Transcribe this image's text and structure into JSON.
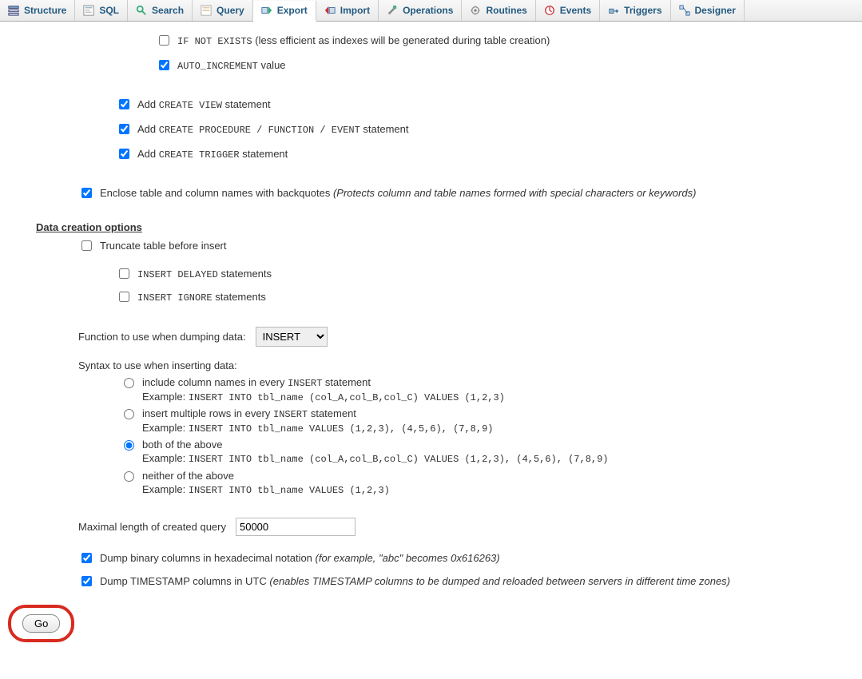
{
  "tabs": [
    {
      "label": "Structure"
    },
    {
      "label": "SQL"
    },
    {
      "label": "Search"
    },
    {
      "label": "Query"
    },
    {
      "label": "Export"
    },
    {
      "label": "Import"
    },
    {
      "label": "Operations"
    },
    {
      "label": "Routines"
    },
    {
      "label": "Events"
    },
    {
      "label": "Triggers"
    },
    {
      "label": "Designer"
    }
  ],
  "opt_if_not_exists": {
    "code": "IF NOT EXISTS",
    "text": "(less efficient as indexes will be generated during table creation)"
  },
  "opt_auto_inc": {
    "code": "AUTO_INCREMENT",
    "text": "value"
  },
  "opt_create_view": {
    "pre": "Add ",
    "code": "CREATE VIEW",
    "post": " statement"
  },
  "opt_create_proc": {
    "pre": "Add ",
    "code": "CREATE PROCEDURE / FUNCTION / EVENT",
    "post": " statement"
  },
  "opt_create_trigger": {
    "pre": "Add ",
    "code": "CREATE TRIGGER",
    "post": " statement"
  },
  "opt_backquotes": {
    "text": "Enclose table and column names with backquotes ",
    "hint": "(Protects column and table names formed with special characters or keywords)"
  },
  "section_data": "Data creation options",
  "opt_truncate": "Truncate table before insert",
  "opt_insert_delayed": {
    "code": "INSERT DELAYED",
    "post": " statements"
  },
  "opt_insert_ignore": {
    "code": "INSERT IGNORE",
    "post": " statements"
  },
  "func_label": "Function to use when dumping data:",
  "func_select": {
    "options": [
      "INSERT"
    ],
    "value": "INSERT"
  },
  "syntax_label": "Syntax to use when inserting data:",
  "ex_label": "Example: ",
  "radios": [
    {
      "label_pre": "include column names in every ",
      "code": "INSERT",
      "label_post": " statement",
      "example": "INSERT INTO tbl_name (col_A,col_B,col_C) VALUES (1,2,3)"
    },
    {
      "label_pre": "insert multiple rows in every ",
      "code": "INSERT",
      "label_post": " statement",
      "example": "INSERT INTO tbl_name VALUES (1,2,3), (4,5,6), (7,8,9)"
    },
    {
      "label_pre": "both of the above",
      "code": "",
      "label_post": "",
      "example": "INSERT INTO tbl_name (col_A,col_B,col_C) VALUES (1,2,3), (4,5,6), (7,8,9)"
    },
    {
      "label_pre": "neither of the above",
      "code": "",
      "label_post": "",
      "example": "INSERT INTO tbl_name VALUES (1,2,3)"
    }
  ],
  "max_len": {
    "label": "Maximal length of created query",
    "value": "50000"
  },
  "opt_hex": {
    "text": "Dump binary columns in hexadecimal notation ",
    "hint": "(for example, \"abc\" becomes 0x616263)"
  },
  "opt_utc": {
    "text": "Dump TIMESTAMP columns in UTC ",
    "hint": "(enables TIMESTAMP columns to be dumped and reloaded between servers in different time zones)"
  },
  "go": "Go",
  "colors": {
    "accent": "#235a81",
    "highlight": "#d82a1f"
  }
}
